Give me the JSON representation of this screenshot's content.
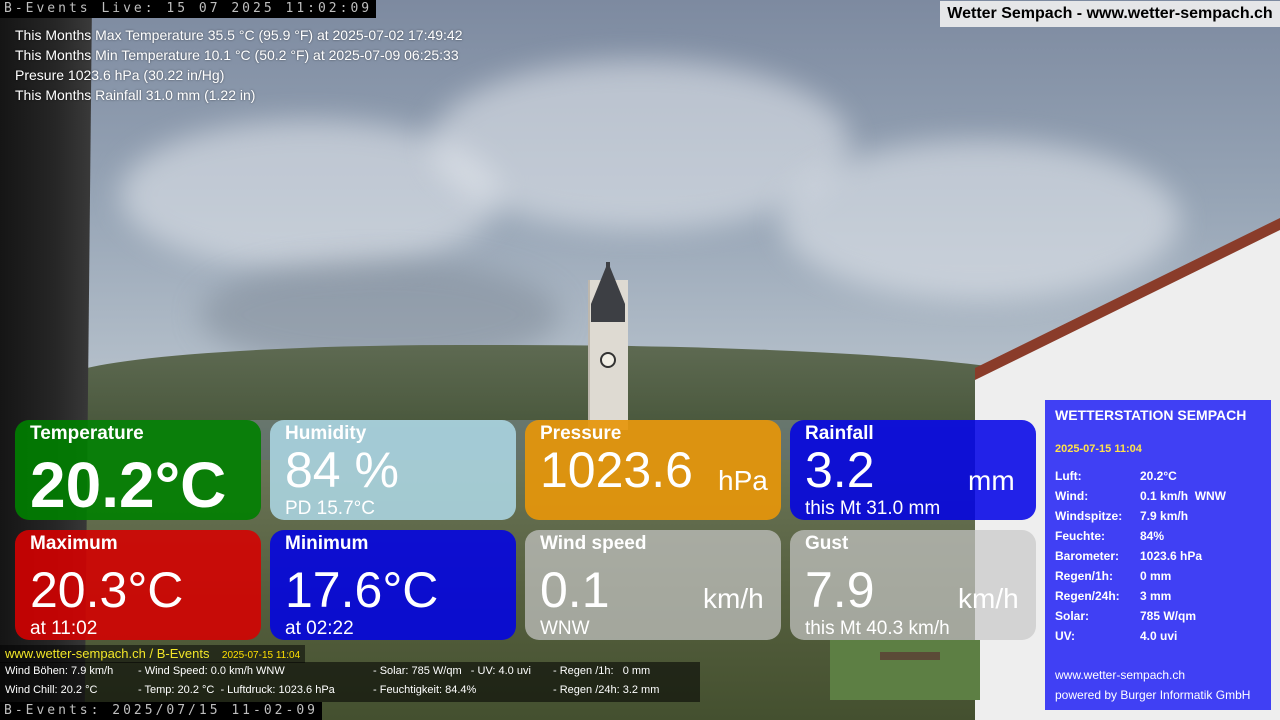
{
  "osd": {
    "top": "B-Events Live: 15 07 2025 11:02:09",
    "bottom": "B-Events: 2025/07/15 11-02-09"
  },
  "header": {
    "title": "Wetter Sempach - www.wetter-sempach.ch"
  },
  "month_stats": [
    "This Months Max Temperature 35.5 °C (95.9 °F) at 2025-07-02 17:49:42",
    "This Months Min Temperature 10.1 °C (50.2 °F) at 2025-07-09 06:25:33",
    "Presure 1023.6 hPa (30.22 in/Hg)",
    "This Months Rainfall 31.0 mm (1.22 in)"
  ],
  "tiles": {
    "temperature": {
      "title": "Temperature",
      "value": "20.2°C",
      "color": "#008000"
    },
    "humidity": {
      "title": "Humidity",
      "value": "84 %",
      "sub": "PD 15.7°C",
      "color": "#add8e6"
    },
    "pressure": {
      "title": "Pressure",
      "value": "1023.6",
      "unit": "hPa",
      "color": "#e6960a"
    },
    "rainfall": {
      "title": "Rainfall",
      "value": "3.2",
      "unit": "mm",
      "sub": "this Mt 31.0 mm",
      "color": "#0000e6"
    },
    "maximum": {
      "title": "Maximum",
      "value": "20.3°C",
      "sub": "at 11:02",
      "color": "#d70000"
    },
    "minimum": {
      "title": "Minimum",
      "value": "17.6°C",
      "sub": "at 02:22",
      "color": "#0000e6"
    },
    "wind_speed": {
      "title": "Wind speed",
      "value": "0.1",
      "unit": "km/h",
      "sub": "WNW",
      "color": "#c8c8c8"
    },
    "gust": {
      "title": "Gust",
      "value": "7.9",
      "unit": "km/h",
      "sub": "this Mt 40.3 km/h",
      "color": "#c8c8c8"
    }
  },
  "station": {
    "title": "WETTERSTATION SEMPACH",
    "datetime": "2025-07-15 11:04",
    "rows": [
      {
        "label": "Luft:",
        "value": "20.2°C"
      },
      {
        "label": "Wind:",
        "value": "0.1 km/h  WNW"
      },
      {
        "label": "Windspitze:",
        "value": "7.9 km/h"
      },
      {
        "label": "Feuchte:",
        "value": "84%"
      },
      {
        "label": "Barometer:",
        "value": "1023.6 hPa"
      },
      {
        "label": "Regen/1h:",
        "value": "0 mm"
      },
      {
        "label": "Regen/24h:",
        "value": "3 mm"
      },
      {
        "label": "Solar:",
        "value": "785 W/qm"
      },
      {
        "label": "UV:",
        "value": "4.0 uvi"
      }
    ],
    "site": "www.wetter-sempach.ch",
    "powered": "powered by Burger Informatik GmbH",
    "color": "#2828f5"
  },
  "infobar": {
    "site": "www.wetter-sempach.ch / B-Events",
    "datetime": "2025-07-15 11:04",
    "row1": {
      "wind_gusts": "Wind Böhen: 7.9 km/h",
      "wind_speed": "- Wind Speed: 0.0 km/h WNW",
      "solar_uv": "- Solar: 785 W/qm   - UV: 4.0 uvi",
      "rain_1h": "- Regen /1h:   0 mm"
    },
    "row2": {
      "wind_chill": "Wind Chill: 20.2 °C",
      "temp_pressure": "- Temp: 20.2 °C  - Luftdruck: 1023.6 hPa",
      "humidity": "- Feuchtigkeit: 84.4%",
      "rain_24h": "- Regen /24h: 3.2 mm"
    }
  }
}
